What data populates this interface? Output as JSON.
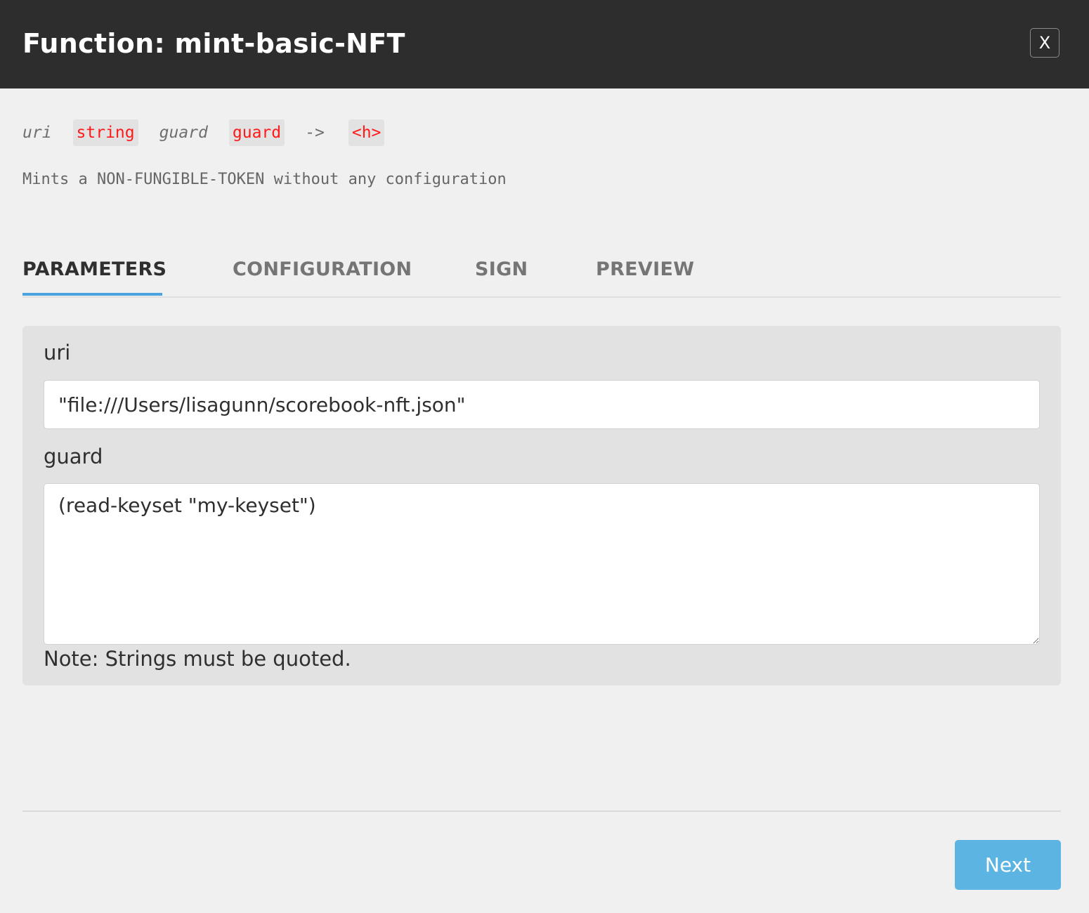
{
  "header": {
    "title": "Function: mint-basic-NFT",
    "close_label": "X"
  },
  "signature": {
    "params": [
      {
        "name": "uri",
        "type": "string"
      },
      {
        "name": "guard",
        "type": "guard"
      }
    ],
    "arrow": "->",
    "return_type": "<h>"
  },
  "description": "Mints a NON-FUNGIBLE-TOKEN without any configuration",
  "tabs": [
    {
      "label": "PARAMETERS",
      "active": true
    },
    {
      "label": "CONFIGURATION",
      "active": false
    },
    {
      "label": "SIGN",
      "active": false
    },
    {
      "label": "PREVIEW",
      "active": false
    }
  ],
  "parameters": {
    "uri": {
      "label": "uri",
      "value": "\"file:///Users/lisagunn/scorebook-nft.json\""
    },
    "guard": {
      "label": "guard",
      "value": "(read-keyset \"my-keyset\")"
    },
    "note": "Note: Strings must be quoted."
  },
  "footer": {
    "next_label": "Next"
  },
  "colors": {
    "header_bg": "#2d2d2d",
    "page_bg": "#f0f0f0",
    "type_text": "#ff1a1a",
    "accent": "#4aa3df",
    "next_button": "#5bb4e1"
  }
}
